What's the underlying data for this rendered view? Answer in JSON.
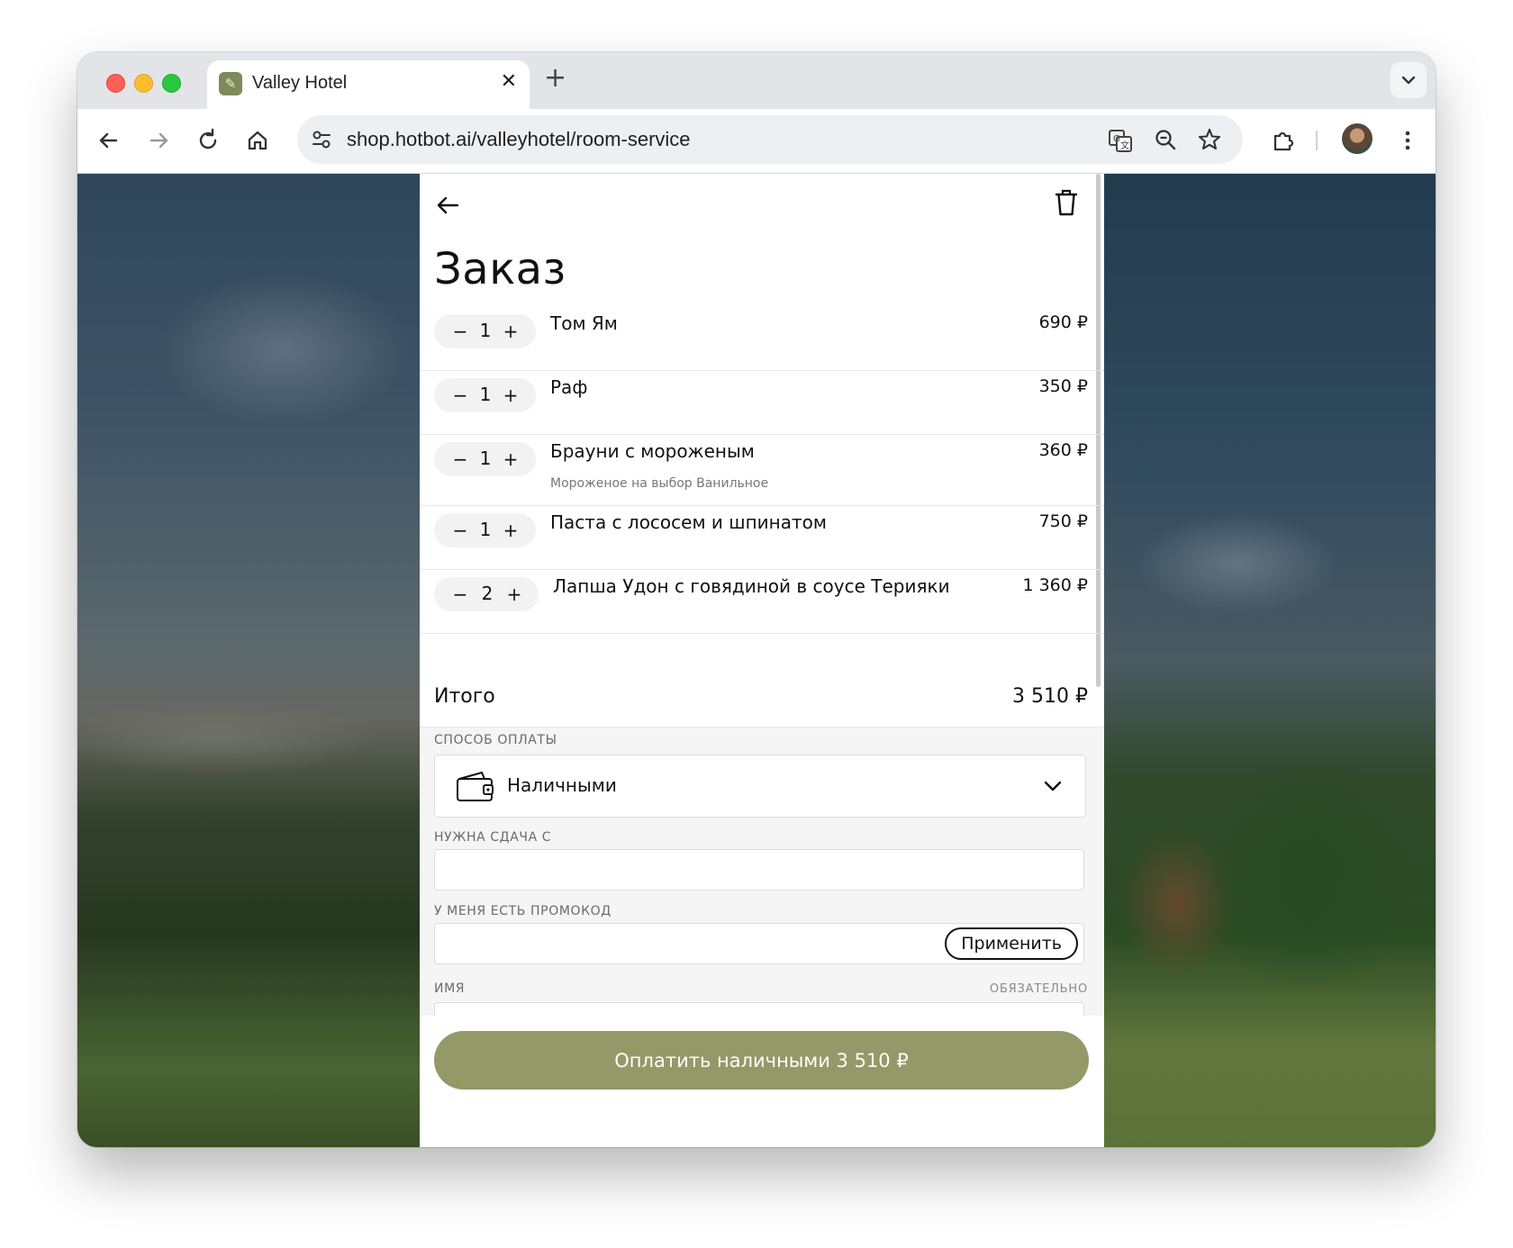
{
  "browser": {
    "tab_title": "Valley Hotel",
    "url": "shop.hotbot.ai/valleyhotel/room-service",
    "url_host": "shop.hotbot.ai",
    "url_path": "/valleyhotel/room-service"
  },
  "order": {
    "title": "Заказ",
    "items": [
      {
        "qty": "1",
        "name": "Том Ям",
        "price": "690 ₽",
        "modifier": ""
      },
      {
        "qty": "1",
        "name": "Раф",
        "price": "350 ₽",
        "modifier": ""
      },
      {
        "qty": "1",
        "name": "Брауни с мороженым",
        "price": "360 ₽",
        "modifier": "Мороженое на выбор Ванильное"
      },
      {
        "qty": "1",
        "name": "Паста с лососем и шпинатом",
        "price": "750 ₽",
        "modifier": ""
      },
      {
        "qty": "2",
        "name": "Лапша Удон с говядиной в соусе Терияки",
        "price": "1 360 ₽",
        "modifier": ""
      }
    ],
    "total_label": "Итого",
    "total_value": "3 510 ₽"
  },
  "form": {
    "payment_label": "СПОСОБ ОПЛАТЫ",
    "payment_value": "Наличными",
    "change_label": "НУЖНА СДАЧА С",
    "change_value": "",
    "promo_label": "У МЕНЯ ЕСТЬ ПРОМОКОД",
    "promo_value": "",
    "apply_label": "Применить",
    "name_label": "ИМЯ",
    "name_required": "ОБЯЗАТЕЛЬНО",
    "name_value": ""
  },
  "pay_button": "Оплатить наличными 3 510 ₽",
  "colors": {
    "accent": "#959968",
    "panel_bg": "#ffffff",
    "form_bg": "#f5f5f5"
  }
}
